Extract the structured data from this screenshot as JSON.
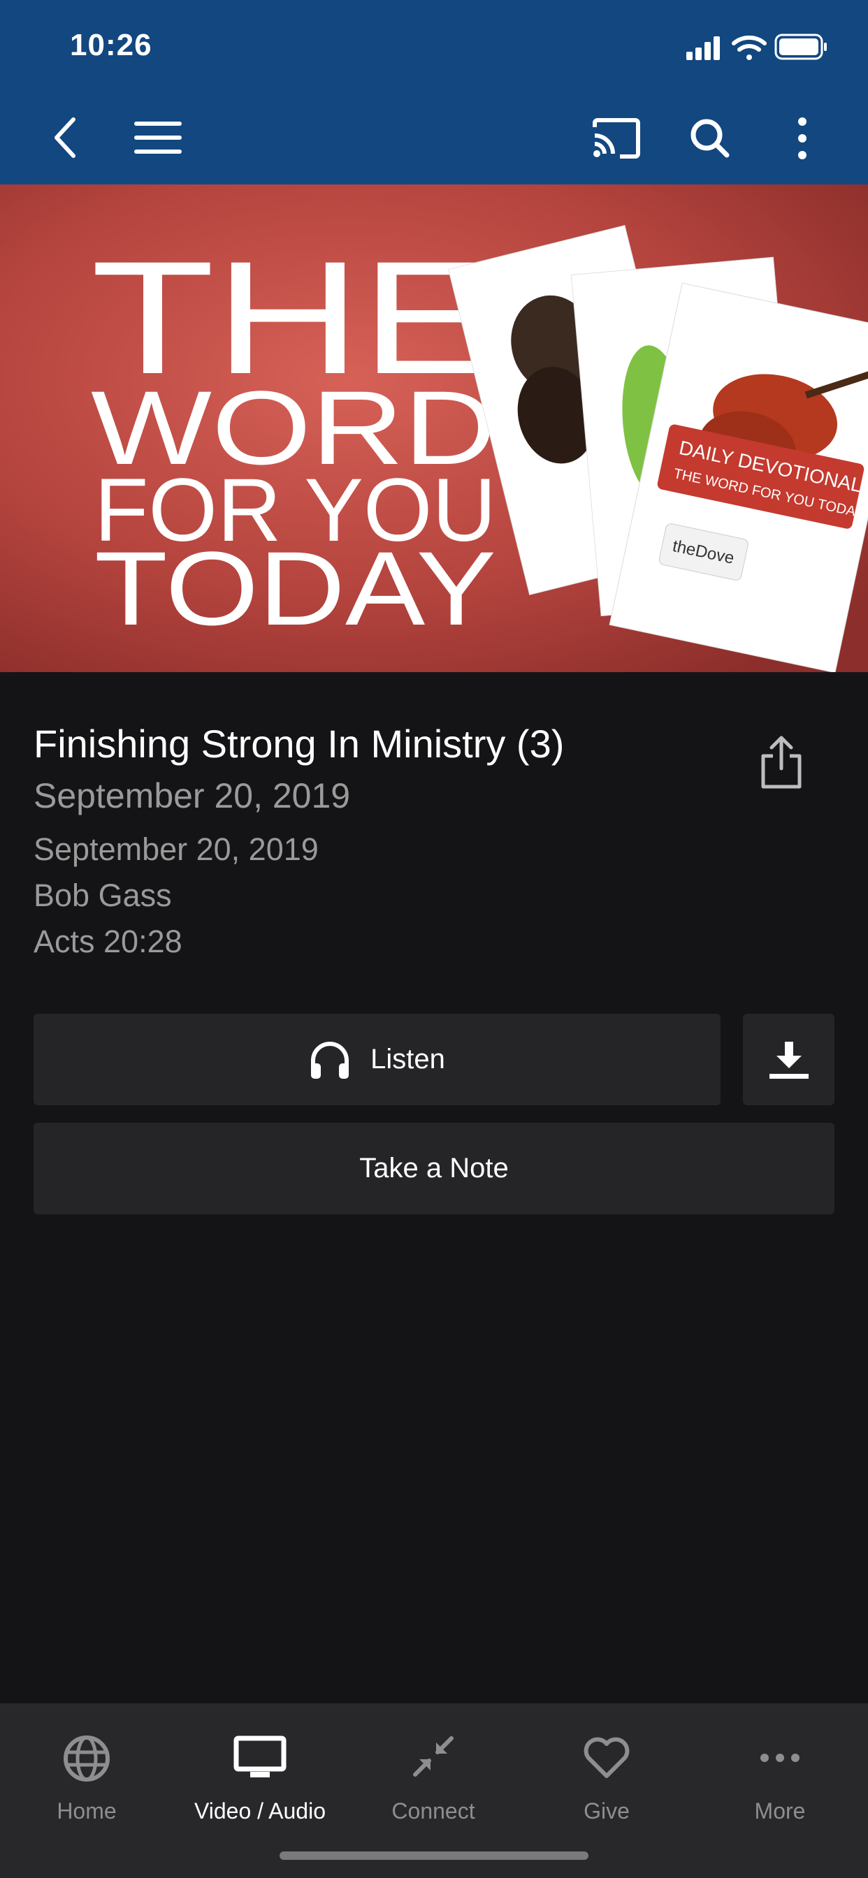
{
  "status_bar": {
    "time": "10:26"
  },
  "hero": {
    "line1": "THE",
    "line2": "WORD",
    "line3": "FOR YOU",
    "line4": "TODAY",
    "booklet_title": "DAILY DEVOTIONAL",
    "booklet_subtitle": "THE WORD FOR YOU TODAY",
    "booklet_brand": "theDove"
  },
  "content": {
    "title": "Finishing Strong In Ministry (3)",
    "date_large": "September 20, 2019",
    "date": "September 20, 2019",
    "author": "Bob Gass",
    "scripture": "Acts 20:28"
  },
  "buttons": {
    "listen_label": "Listen",
    "note_label": "Take a Note"
  },
  "tabs": [
    {
      "label": "Home",
      "icon": "globe-icon"
    },
    {
      "label": "Video / Audio",
      "icon": "tv-icon"
    },
    {
      "label": "Connect",
      "icon": "compress-arrows-icon"
    },
    {
      "label": "Give",
      "icon": "heart-icon"
    },
    {
      "label": "More",
      "icon": "more-dots-icon"
    }
  ],
  "colors": {
    "header": "#124780",
    "background": "#141416",
    "button": "#252527",
    "tabbar": "#28282b",
    "hero_red": "#b94a43"
  }
}
